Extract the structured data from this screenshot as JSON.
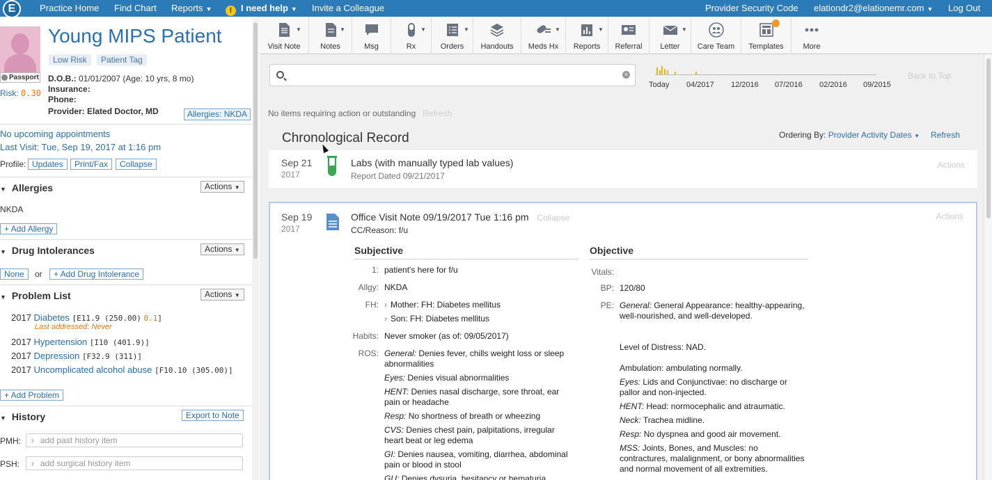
{
  "topnav": {
    "logo": "E",
    "items": [
      "Practice Home",
      "Find Chart",
      "Reports"
    ],
    "help": "I need help",
    "invite": "Invite a Colleague",
    "security": "Provider Security Code",
    "user": "elationdr2@elationemr.com",
    "logout": "Log Out"
  },
  "patient": {
    "name": "Young MIPS Patient",
    "tags": [
      "Low Risk",
      "Patient Tag"
    ],
    "passport": "Passport",
    "risk_label": "Risk:",
    "risk_value": "0.30",
    "dob_label": "D.O.B.:",
    "dob_value": "01/01/2007 (Age: 10 yrs, 8 mo)",
    "insurance_label": "Insurance:",
    "phone_label": "Phone:",
    "provider_label": "Provider:",
    "provider_value": "Elated Doctor, MD",
    "allergies_btn": "Allergies: NKDA",
    "upcoming": "No upcoming appointments",
    "last_visit": "Last Visit: Tue, Sep 19, 2017 at 1:16 pm",
    "profile_label": "Profile:",
    "profile_btns": [
      "Updates",
      "Print/Fax",
      "Collapse"
    ]
  },
  "allergies": {
    "title": "Allergies",
    "actions": "Actions",
    "value": "NKDA",
    "add": "+ Add Allergy"
  },
  "intolerances": {
    "title": "Drug Intolerances",
    "actions": "Actions",
    "none": "None",
    "or": "or",
    "add": "+ Add Drug Intolerance"
  },
  "problems": {
    "title": "Problem List",
    "actions": "Actions",
    "items": [
      {
        "year": "2017",
        "name": "Diabetes",
        "code": "[E11.9 (250.00)",
        "score": "0.1",
        "close": "]"
      },
      {
        "year": "2017",
        "name": "Hypertension",
        "code": "[I10 (401.9)]"
      },
      {
        "year": "2017",
        "name": "Depression",
        "code": "[F32.9 (311)]"
      },
      {
        "year": "2017",
        "name": "Uncomplicated alcohol abuse",
        "code": "[F10.10 (305.00)]"
      }
    ],
    "last_addressed": "Last addressed: Never",
    "add": "+ Add Problem"
  },
  "history": {
    "title": "History",
    "export": "Export to Note",
    "pmh_label": "PMH:",
    "pmh_placeholder": "add past history item",
    "psh_label": "PSH:",
    "psh_placeholder": "add surgical history item"
  },
  "toolbar": {
    "buttons": [
      "Visit Note",
      "Notes",
      "Msg",
      "Rx",
      "Orders",
      "Handouts",
      "Meds Hx",
      "Reports",
      "Referral",
      "Letter",
      "Care Team",
      "Templates",
      "More"
    ]
  },
  "timeline": {
    "ticks": [
      "Today",
      "04/2017",
      "12/2016",
      "07/2016",
      "02/2016",
      "09/2015"
    ],
    "back_to_top": "Back to Top"
  },
  "main": {
    "no_items": "No items requiring action or outstanding",
    "refresh": "Refresh",
    "chrono_title": "Chronological Record",
    "ordering_label": "Ordering By:",
    "ordering_value": "Provider Activity Dates",
    "ordering_refresh": "Refresh"
  },
  "labs_card": {
    "date": "Sep 21",
    "year": "2017",
    "title": "Labs (with manually typed lab values)",
    "sub": "Report Dated 09/21/2017",
    "actions": "Actions"
  },
  "note_card": {
    "date": "Sep 19",
    "year": "2017",
    "title": "Office Visit Note 09/19/2017 Tue 1:16 pm",
    "collapse": "Collapse",
    "cc": "CC/Reason: f/u",
    "actions": "Actions",
    "subjective": {
      "heading": "Subjective",
      "rows": [
        {
          "label": "1:",
          "value": "patient's here for f/u"
        },
        {
          "label": "Allgy:",
          "value": "NKDA"
        },
        {
          "label": "FH:",
          "value": "Mother: FH: Diabetes mellitus"
        },
        {
          "label": "",
          "value": "Son: FH: Diabetes mellitus"
        },
        {
          "label": "Habits:",
          "value": "Never smoker (as of: 09/05/2017)"
        }
      ],
      "ros_label": "ROS:",
      "ros": [
        {
          "sys": "General:",
          "text": "Denies fever, chills weight loss or sleep abnormalities"
        },
        {
          "sys": "Eyes:",
          "text": "Denies visual abnormalities"
        },
        {
          "sys": "HENT:",
          "text": "Denies nasal discharge, sore throat, ear pain or headache"
        },
        {
          "sys": "Resp:",
          "text": "No shortness of breath or wheezing"
        },
        {
          "sys": "CVS:",
          "text": "Denies chest pain, palpitations, irregular heart beat or leg edema"
        },
        {
          "sys": "GI:",
          "text": "Denies nausea, vomiting, diarrhea, abdominal pain or blood in stool"
        },
        {
          "sys": "GU:",
          "text": "Denies dysuria, hesitancy or hematuria"
        }
      ]
    },
    "objective": {
      "heading": "Objective",
      "vitals_label": "Vitals:",
      "bp_label": "BP:",
      "bp_value": "120/80",
      "pe_label": "PE:",
      "pe": [
        {
          "sys": "General:",
          "text": "General Appearance: healthy-appearing, well-nourished, and well-developed."
        },
        {
          "sys": "",
          "text": "Level of Distress: NAD."
        },
        {
          "sys": "",
          "text": "Ambulation: ambulating normally."
        },
        {
          "sys": "Eyes:",
          "text": "Lids and Conjunctivae: no discharge or pallor and non-injected."
        },
        {
          "sys": "HENT:",
          "text": "Head: normocephalic and atraumatic."
        },
        {
          "sys": "Neck:",
          "text": "Trachea midline."
        },
        {
          "sys": "Resp:",
          "text": "No dyspnea and good air movement."
        },
        {
          "sys": "MSS:",
          "text": "Joints, Bones, and Muscles: no contractures, malalignment, or bony abnormalities and normal movement of all extremities."
        }
      ]
    }
  }
}
